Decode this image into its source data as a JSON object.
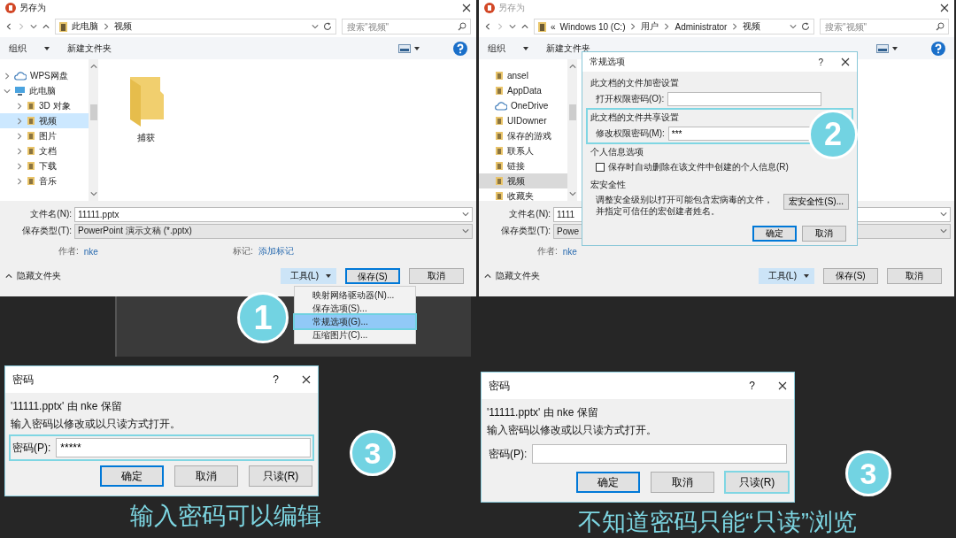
{
  "save_dialogs": [
    {
      "title": "另存为",
      "active": true,
      "breadcrumb": [
        "此电脑",
        "视频"
      ],
      "search_placeholder": "搜索\"视频\"",
      "organize": "组织",
      "new_folder": "新建文件夹",
      "nav": [
        {
          "label": "WPS网盘",
          "kind": "cloud",
          "expanded": false,
          "selected": false
        },
        {
          "label": "此电脑",
          "kind": "pc",
          "expanded": true,
          "selected": false,
          "children": [
            {
              "label": "3D 对象",
              "kind": "folder",
              "expanded": false,
              "selected": false
            },
            {
              "label": "视频",
              "kind": "folder",
              "expanded": false,
              "selected": true
            },
            {
              "label": "图片",
              "kind": "folder",
              "expanded": false,
              "selected": false
            },
            {
              "label": "文档",
              "kind": "folder",
              "expanded": false,
              "selected": false
            },
            {
              "label": "下载",
              "kind": "folder",
              "expanded": false,
              "selected": false
            },
            {
              "label": "音乐",
              "kind": "folder",
              "expanded": false,
              "selected": false
            }
          ]
        }
      ],
      "files": [
        "捕获"
      ],
      "fields": [
        {
          "label": "文件名(N):",
          "value": "11111.pptx"
        },
        {
          "label": "保存类型(T):",
          "value": "PowerPoint 演示文稿 (*.pptx)"
        }
      ],
      "author_label": "作者:",
      "author": "nke",
      "tags_label": "标记:",
      "tags": "添加标记",
      "hide_folders": "隐藏文件夹",
      "tools": "工具(L)",
      "save": "保存(S)",
      "cancel": "取消",
      "tools_menu": {
        "step": "1",
        "items": [
          {
            "label": "映射网络驱动器(N)...",
            "selected": false
          },
          {
            "label": "保存选项(S)...",
            "selected": false
          },
          {
            "label": "常规选项(G)...",
            "selected": true
          },
          {
            "label": "压缩图片(C)...",
            "selected": false
          }
        ]
      }
    },
    {
      "title": "另存为",
      "active": false,
      "overflow_mark": "«",
      "breadcrumb": [
        "Windows 10 (C:)",
        "用户",
        "Administrator",
        "视频"
      ],
      "search_placeholder": "搜索\"视频\"",
      "organize": "组织",
      "new_folder": "新建文件夹",
      "nav": [
        {
          "label": "ansel",
          "kind": "folder",
          "selected": false
        },
        {
          "label": "AppData",
          "kind": "folder",
          "selected": false
        },
        {
          "label": "OneDrive",
          "kind": "cloud",
          "selected": false
        },
        {
          "label": "UIDowner",
          "kind": "folder",
          "selected": false
        },
        {
          "label": "保存的游戏",
          "kind": "folder",
          "selected": false
        },
        {
          "label": "联系人",
          "kind": "folder",
          "selected": false
        },
        {
          "label": "链接",
          "kind": "folder",
          "selected": false
        },
        {
          "label": "视频",
          "kind": "folder",
          "selected": true
        },
        {
          "label": "收藏夹",
          "kind": "folder",
          "selected": false
        }
      ],
      "fields": [
        {
          "label": "文件名(N):",
          "value": "1111"
        },
        {
          "label": "保存类型(T):",
          "value": "Powe"
        }
      ],
      "author_label": "作者:",
      "author": "nke",
      "hide_folders": "隐藏文件夹",
      "tools": "工具(L)",
      "save": "保存(S)",
      "cancel": "取消",
      "options_dialog": {
        "title": "常规选项",
        "help": "?",
        "step": "2",
        "sections": [
          {
            "kind": "password",
            "heading": "此文档的文件加密设置",
            "label": "打开权限密码(O):",
            "highlighted": false
          },
          {
            "kind": "password",
            "heading": "此文档的文件共享设置",
            "label": "修改权限密码(M):",
            "value": "***",
            "highlighted": true
          },
          {
            "kind": "checkbox",
            "heading": "个人信息选项",
            "label": "保存时自动删除在该文件中创建的个人信息(R)",
            "checked": false,
            "highlighted": false
          },
          {
            "kind": "macro",
            "heading": "宏安全性",
            "text": "调整安全级别以打开可能包含宏病毒的文件，并指定可信任的宏创建者姓名。",
            "button": "宏安全性(S)...",
            "highlighted": false
          }
        ],
        "buttons": [
          "确定",
          "取消"
        ]
      }
    }
  ],
  "password_dialogs": [
    {
      "title": "密码",
      "help": "?",
      "owner_line": "'11111.pptx' 由 nke 保留",
      "prompt": "输入密码以修改或以只读方式打开。",
      "label": "密码(P):",
      "value": "*****",
      "field_highlighted": true,
      "readonly_highlighted": false,
      "step": "3",
      "buttons": [
        "确定",
        "取消",
        "只读(R)"
      ],
      "caption": "输入密码可以编辑"
    },
    {
      "title": "密码",
      "help": "?",
      "owner_line": "'11111.pptx' 由 nke 保留",
      "prompt": "输入密码以修改或以只读方式打开。",
      "label": "密码(P):",
      "field_highlighted": false,
      "readonly_highlighted": true,
      "step": "3",
      "buttons": [
        "确定",
        "取消",
        "只读(R)"
      ],
      "caption": "不知道密码只能“只读”浏览"
    }
  ]
}
